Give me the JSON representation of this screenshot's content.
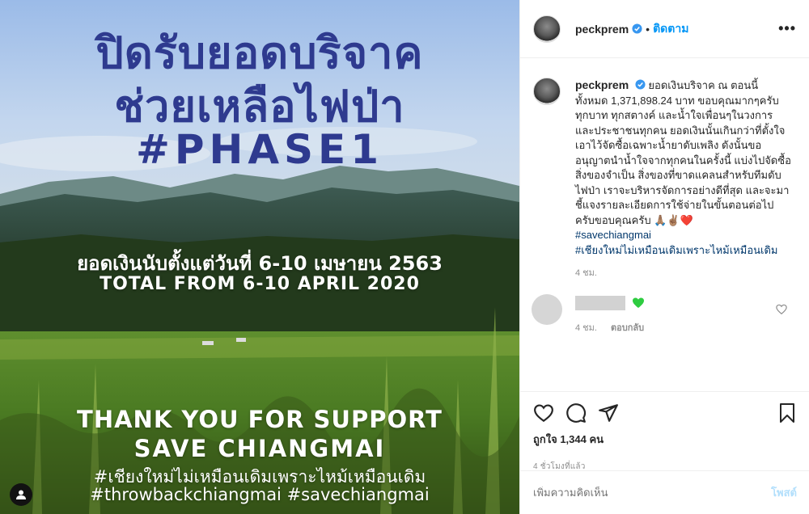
{
  "image_text": {
    "title_line1": "ปิดรับยอดบริจาค",
    "title_line2": "ช่วยเหลือไฟป่า",
    "title_line3": "#PHASE1",
    "total_th": "ยอดเงินนับตั้งแต่วันที่ 6-10 เมษายน 2563",
    "total_en": "TOTAL FROM 6-10 APRIL 2020",
    "thanks": "THANK YOU FOR SUPPORT",
    "save": "SAVE CHIANGMAI",
    "hashtag1": "#เชียงใหม่ไม่เหมือนเดิมเพราะไหม้เหมือนเดิม",
    "hashtag2": "#throwbackchiangmai #savechiangmai"
  },
  "header": {
    "username": "peckprem",
    "separator": "•",
    "follow_label": "ติดตาม",
    "more_icon": "more-horizontal-icon"
  },
  "caption": {
    "username": "peckprem",
    "text": "ยอดเงินบริจาค ณ ตอนนี้ ทั้งหมด 1,371,898.24 บาท ขอบคุณมากๆครับ ทุกบาท ทุกสตางค์ และน้ำใจเพื่อนๆในวงการ และประชาชนทุกคน ยอดเงินนั้นเกินกว่าที่ตั้งใจเอาไว้จัดซื้อเฉพาะน้ำยาดับเพลิง ดังนั้นขออนุญาตนำน้ำใจจากทุกคนในครั้งนี้ แบ่งไปจัดซื้อสิ่งของจำเป็น สิ่งของที่ขาดแคลนสำหรับทีมดับไฟป่า เราจะบริหารจัดการอย่างดีที่สุด และจะมาชี้แจงรายละเอียดการใช้จ่ายในขั้นตอนต่อไปครับขอบคุณครับ 🙏🏽✌🏽❤️",
    "hashtag1": "#savechiangmai",
    "hashtag2": "#เชียงใหม่ไม่เหมือนเดิมเพราะไหม้เหมือนเดิม",
    "time": "4 ชม."
  },
  "comment": {
    "time": "4 ชม.",
    "reply_label": "ตอบกลับ"
  },
  "actions": {
    "likes": "ถูกใจ 1,344 คน",
    "timestamp": "4 ชั่วโมงที่แล้ว"
  },
  "add_comment": {
    "placeholder": "เพิ่มความคิดเห็น",
    "post_label": "โพสต์"
  },
  "colors": {
    "accent": "#0095f6",
    "title_blue": "#2e3a8f",
    "verified": "#3897f0",
    "heart_green": "#2ecc40"
  }
}
